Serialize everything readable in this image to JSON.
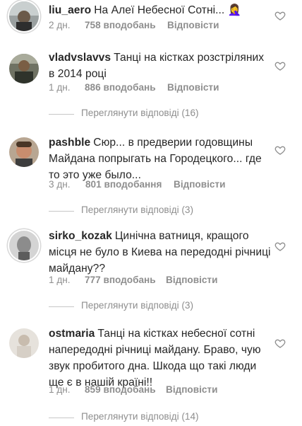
{
  "comments": [
    {
      "username": "liu_aero",
      "text": "На Алеї Небесної Сотні...",
      "emoji": "🤦‍♀️",
      "time": "2 дн.",
      "likes": "758 вподобань",
      "reply": "Відповісти",
      "avatar": "avatar-liu-aero"
    },
    {
      "username": "vladvslavvs",
      "text": "Танці на кістках розстріляних в 2014 році",
      "time": "1 дн.",
      "likes": "886 вподобань",
      "reply": "Відповісти",
      "view_replies": "Переглянути відповіді (16)",
      "avatar": "avatar-vladvslavvs"
    },
    {
      "username": "pashble",
      "text": "Сюр... в предверии годовщины Майдана попрыгать на Городецкого... где то это уже было...",
      "time": "3 дн.",
      "likes": "801 вподобання",
      "reply": "Відповісти",
      "view_replies": "Переглянути відповіді (3)",
      "avatar": "avatar-pashble"
    },
    {
      "username": "sirko_kozak",
      "text": "Цинічна ватниця, кращого місця не було в Киева на передодні річниці майдану??",
      "time": "1 дн.",
      "likes": "777 вподобань",
      "reply": "Відповісти",
      "view_replies": "Переглянути відповіді (3)",
      "avatar": "avatar-sirko-kozak"
    },
    {
      "username": "ostmaria",
      "text": "Танці на кістках небесної сотні напередодні річниці майдану. Браво, чую звук пробитого дна. Шкода що такі люди ще є в нашій країні!!",
      "time": "1 дн.",
      "likes": "859 вподобань",
      "reply": "Відповісти",
      "view_replies": "Переглянути відповіді (14)",
      "avatar": "avatar-ostmaria"
    }
  ],
  "icons": {
    "like": "heart-outline-icon"
  },
  "colors": {
    "text": "#262626",
    "meta": "#8e8e8e",
    "divider": "#c7c7c7"
  }
}
